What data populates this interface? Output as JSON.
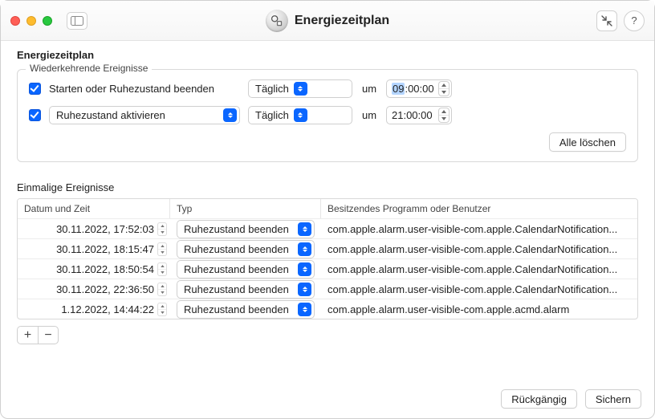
{
  "window": {
    "title": "Energiezeitplan"
  },
  "header": {
    "title": "Energiezeitplan"
  },
  "recurring": {
    "group_label": "Wiederkehrende Ereignisse",
    "row1": {
      "label": "Starten oder Ruhezustand beenden",
      "frequency": "Täglich",
      "um": "um",
      "hh": "09",
      "rest": ":00:00"
    },
    "row2": {
      "action": "Ruhezustand aktivieren",
      "frequency": "Täglich",
      "um": "um",
      "time": "21:00:00"
    },
    "clear_all": "Alle löschen"
  },
  "onetime": {
    "label": "Einmalige Ereignisse",
    "columns": {
      "datetime": "Datum und Zeit",
      "type": "Typ",
      "owner": "Besitzendes Programm oder Benutzer"
    },
    "rows": [
      {
        "datetime": "30.11.2022, 17:52:03",
        "type": "Ruhezustand beenden",
        "owner": "com.apple.alarm.user-visible-com.apple.CalendarNotification..."
      },
      {
        "datetime": "30.11.2022, 18:15:47",
        "type": "Ruhezustand beenden",
        "owner": "com.apple.alarm.user-visible-com.apple.CalendarNotification..."
      },
      {
        "datetime": "30.11.2022, 18:50:54",
        "type": "Ruhezustand beenden",
        "owner": "com.apple.alarm.user-visible-com.apple.CalendarNotification..."
      },
      {
        "datetime": "30.11.2022, 22:36:50",
        "type": "Ruhezustand beenden",
        "owner": "com.apple.alarm.user-visible-com.apple.CalendarNotification..."
      },
      {
        "datetime": "1.12.2022, 14:44:22",
        "type": "Ruhezustand beenden",
        "owner": "com.apple.alarm.user-visible-com.apple.acmd.alarm"
      }
    ]
  },
  "footer": {
    "revert": "Rückgängig",
    "save": "Sichern"
  }
}
